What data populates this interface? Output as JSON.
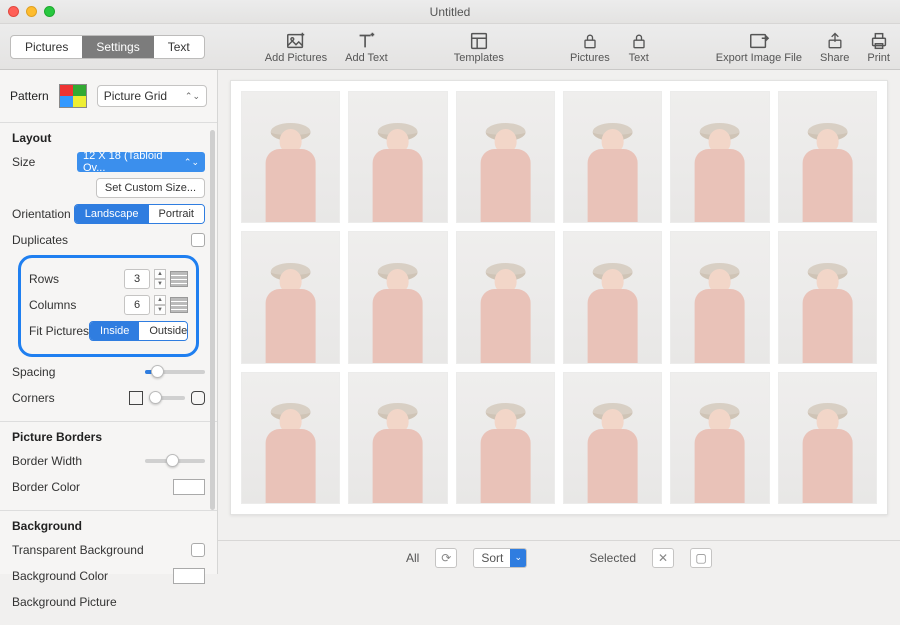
{
  "window": {
    "title": "Untitled"
  },
  "tabs": {
    "pictures": "Pictures",
    "settings": "Settings",
    "text": "Text",
    "active": "settings"
  },
  "toolbar": {
    "add_pictures": "Add Pictures",
    "add_text": "Add Text",
    "templates": "Templates",
    "lock_pictures": "Pictures",
    "lock_text": "Text",
    "export": "Export Image File",
    "share": "Share",
    "print": "Print"
  },
  "sidebar": {
    "pattern_label": "Pattern",
    "pattern_value": "Picture Grid",
    "layout": {
      "heading": "Layout",
      "size_label": "Size",
      "size_value": "12 X 18 (Tabloid Ov...",
      "custom_size_btn": "Set Custom Size...",
      "orientation_label": "Orientation",
      "orientation_landscape": "Landscape",
      "orientation_portrait": "Portrait",
      "duplicates_label": "Duplicates",
      "rows_label": "Rows",
      "rows_value": "3",
      "columns_label": "Columns",
      "columns_value": "6",
      "fit_label": "Fit Pictures",
      "fit_inside": "Inside",
      "fit_outside": "Outside",
      "spacing_label": "Spacing",
      "corners_label": "Corners"
    },
    "borders": {
      "heading": "Picture Borders",
      "width_label": "Border Width",
      "color_label": "Border Color"
    },
    "background": {
      "heading": "Background",
      "transparent_label": "Transparent Background",
      "color_label": "Background Color",
      "picture_label": "Background Picture"
    }
  },
  "grid": {
    "rows": 3,
    "cols": 6
  },
  "footer": {
    "all_label": "All",
    "sort_label": "Sort",
    "selected_label": "Selected"
  }
}
